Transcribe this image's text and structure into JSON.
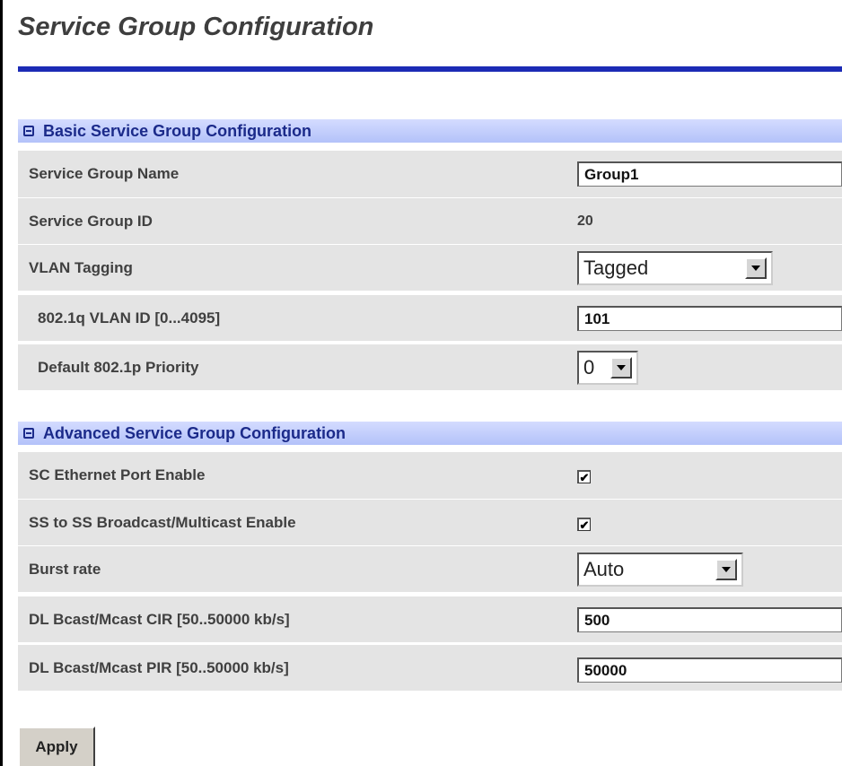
{
  "page": {
    "title": "Service Group Configuration"
  },
  "basic": {
    "header": "Basic Service Group Configuration",
    "rows": {
      "name": {
        "label": "Service Group Name",
        "value": "Group1"
      },
      "id": {
        "label": "Service Group ID",
        "value": "20"
      },
      "vlan_tagging": {
        "label": "VLAN Tagging",
        "selected": "Tagged"
      },
      "vlan_id": {
        "label": "802.1q VLAN ID [0...4095]",
        "value": "101"
      },
      "priority": {
        "label": "Default 802.1p Priority",
        "selected": "0"
      }
    }
  },
  "advanced": {
    "header": "Advanced Service Group Configuration",
    "rows": {
      "sc_ethernet": {
        "label": "SC Ethernet Port Enable",
        "checked": true,
        "mark": "✔"
      },
      "ss_broadcast": {
        "label": "SS to SS Broadcast/Multicast Enable",
        "checked": true,
        "mark": "✔"
      },
      "burst_rate": {
        "label": "Burst rate",
        "selected": "Auto"
      },
      "dl_cir": {
        "label": "DL Bcast/Mcast CIR [50..50000 kb/s]",
        "value": "500"
      },
      "dl_pir": {
        "label": "DL Bcast/Mcast PIR [50..50000 kb/s]",
        "value": "50000"
      }
    }
  },
  "actions": {
    "apply_label": "Apply"
  },
  "colors": {
    "title_rule": "#1c2bb5",
    "section_text": "#1b2a8a",
    "row_bg": "#e4e4e4"
  }
}
